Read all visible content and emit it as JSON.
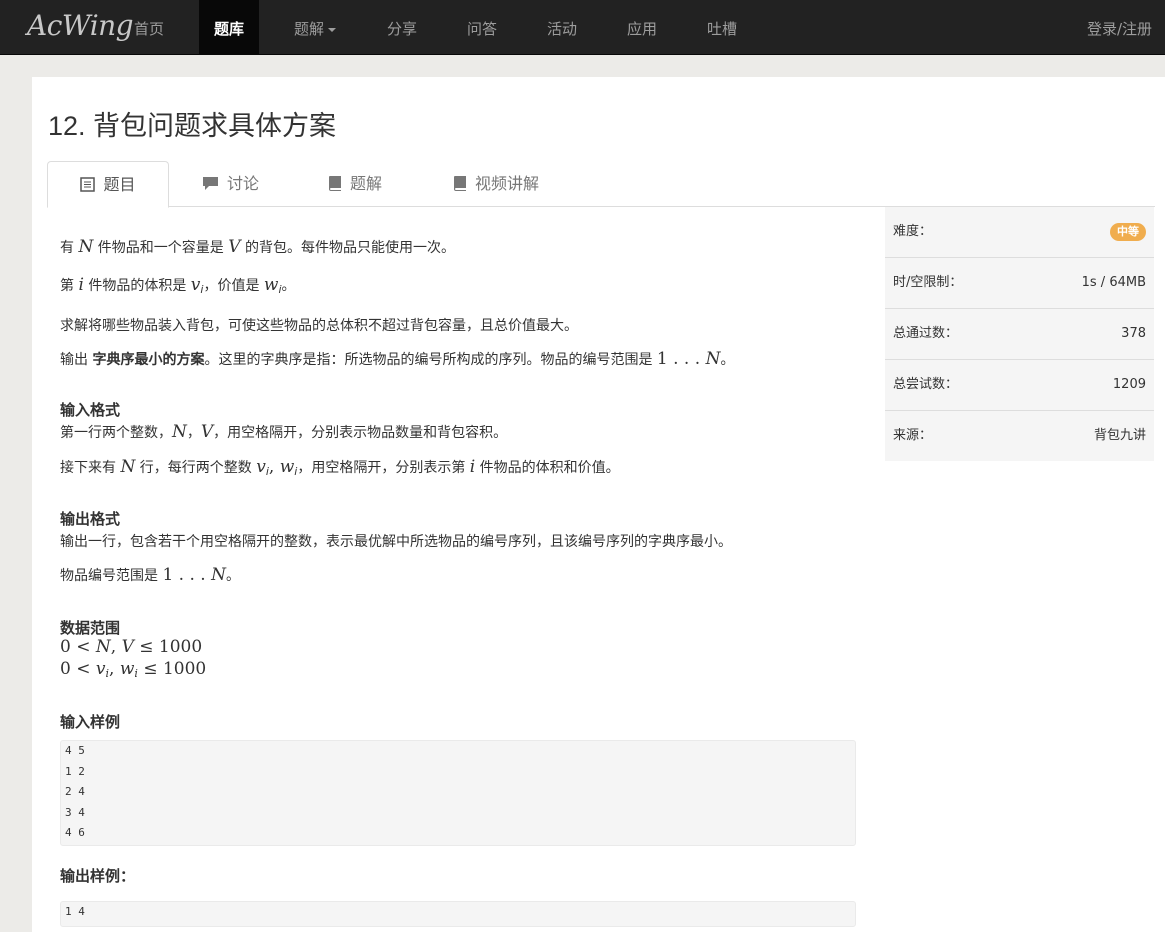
{
  "navbar": {
    "brand": "AcWing",
    "items": [
      "首页",
      "题库",
      "题解",
      "分享",
      "问答",
      "活动",
      "应用",
      "吐槽"
    ],
    "login": "登录/注册"
  },
  "problem": {
    "title": "12. 背包问题求具体方案",
    "tabs": [
      "题目",
      "讨论",
      "题解",
      "视频讲解"
    ],
    "statement": {
      "l1a": "有 ",
      "l1n": "N",
      "l1b": " 件物品和一个容量是 ",
      "l1v": "V",
      "l1c": " 的背包。每件物品只能使用一次。",
      "l2a": "第 ",
      "l2i": "i",
      "l2b": " 件物品的体积是 ",
      "l2v": "v",
      "l2vi": "i",
      "l2c": "，价值是 ",
      "l2w": "w",
      "l2wi": "i",
      "l2d": "。",
      "l3": "求解将哪些物品装入背包，可使这些物品的总体积不超过背包容量，且总价值最大。",
      "l4a": "输出 ",
      "l4b": "字典序最小的方案",
      "l4c": "。这里的字典序是指：所选物品的编号所构成的序列。物品的编号范围是 ",
      "l4m": "1 . . . ",
      "l4n": "N",
      "l4d": "。"
    },
    "input_format": {
      "heading": "输入格式",
      "l1a": "第一行两个整数，",
      "l1n": "N",
      "l1s": "，",
      "l1v": "V",
      "l1b": "，用空格隔开，分别表示物品数量和背包容积。",
      "l2a": "接下来有 ",
      "l2n": "N",
      "l2b": " 行，每行两个整数 ",
      "l2v": "v",
      "l2vi": "i",
      "l2c": ", ",
      "l2w": "w",
      "l2wi": "i",
      "l2d": "，用空格隔开，分别表示第 ",
      "l2i": "i",
      "l2e": " 件物品的体积和价值。"
    },
    "output_format": {
      "heading": "输出格式",
      "l1": "输出一行，包含若干个用空格隔开的整数，表示最优解中所选物品的编号序列，且该编号序列的字典序最小。",
      "l2a": "物品编号范围是 ",
      "l2m": "1 . . . ",
      "l2n": "N",
      "l2b": "。"
    },
    "data_range": {
      "heading": "数据范围",
      "r1a": "0 < ",
      "r1b": "N",
      "r1c": ", ",
      "r1d": "V",
      "r1e": " ≤ 1000",
      "r2a": "0 < ",
      "r2b": "v",
      "r2bi": "i",
      "r2c": ", ",
      "r2d": "w",
      "r2di": "i",
      "r2e": " ≤ 1000"
    },
    "sample_input": {
      "heading": "输入样例",
      "lines": [
        "4 5",
        "1 2",
        "2 4",
        "3 4",
        "4 6"
      ]
    },
    "sample_output": {
      "heading": "输出样例：",
      "lines": [
        "1 4"
      ]
    }
  },
  "sidebar": {
    "rows": [
      {
        "label": "难度：",
        "value": "中等"
      },
      {
        "label": "时/空限制：",
        "value": "1s / 64MB"
      },
      {
        "label": "总通过数：",
        "value": "378"
      },
      {
        "label": "总尝试数：",
        "value": "1209"
      },
      {
        "label": "来源：",
        "value": "背包九讲"
      }
    ]
  },
  "colors": {
    "navbar": "#222222",
    "badge": "#f0ad4e",
    "code_bg": "#f5f5f5"
  }
}
